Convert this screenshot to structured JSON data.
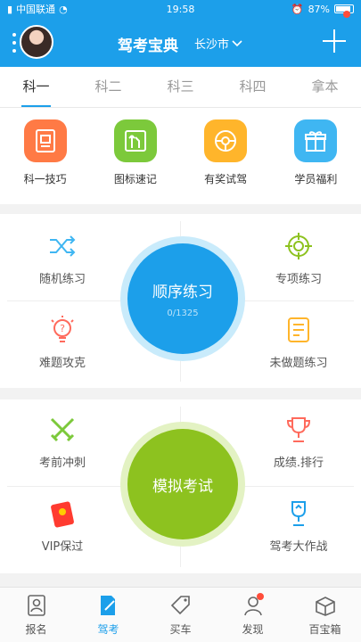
{
  "status_bar": {
    "carrier": "中国联通",
    "time": "19:58",
    "battery": "87%"
  },
  "header": {
    "title": "驾考宝典",
    "city": "长沙市"
  },
  "tabs": [
    {
      "label": "科一",
      "active": true
    },
    {
      "label": "科二",
      "active": false
    },
    {
      "label": "科三",
      "active": false
    },
    {
      "label": "科四",
      "active": false
    },
    {
      "label": "拿本",
      "active": false
    }
  ],
  "tools": [
    {
      "label": "科一技巧",
      "icon": "document-icon",
      "color": "#ff7a45"
    },
    {
      "label": "图标速记",
      "icon": "traffic-sign-icon",
      "color": "#7cc93b"
    },
    {
      "label": "有奖试驾",
      "icon": "steering-wheel-icon",
      "color": "#ffb52b"
    },
    {
      "label": "学员福利",
      "icon": "gift-icon",
      "color": "#3fb6f2"
    }
  ],
  "practice": {
    "random": "随机练习",
    "special": "专项练习",
    "hard": "难题攻克",
    "undone": "未做题练习",
    "center_title": "顺序练习",
    "center_progress": "0/1325"
  },
  "exam": {
    "sprint": "考前冲刺",
    "ranking": "成绩.排行",
    "vip": "VIP保过",
    "battle": "驾考大作战",
    "center_title": "模拟考试"
  },
  "bottom_nav": [
    {
      "label": "报名",
      "icon": "id-card-icon",
      "active": false
    },
    {
      "label": "驾考",
      "icon": "exam-pen-icon",
      "active": true
    },
    {
      "label": "买车",
      "icon": "price-tag-icon",
      "active": false
    },
    {
      "label": "发现",
      "icon": "person-icon",
      "active": false,
      "badge": true
    },
    {
      "label": "百宝箱",
      "icon": "treasure-box-icon",
      "active": false
    }
  ],
  "colors": {
    "primary": "#1c9fea",
    "green": "#8dc21f",
    "badge": "#ff4d3a"
  }
}
